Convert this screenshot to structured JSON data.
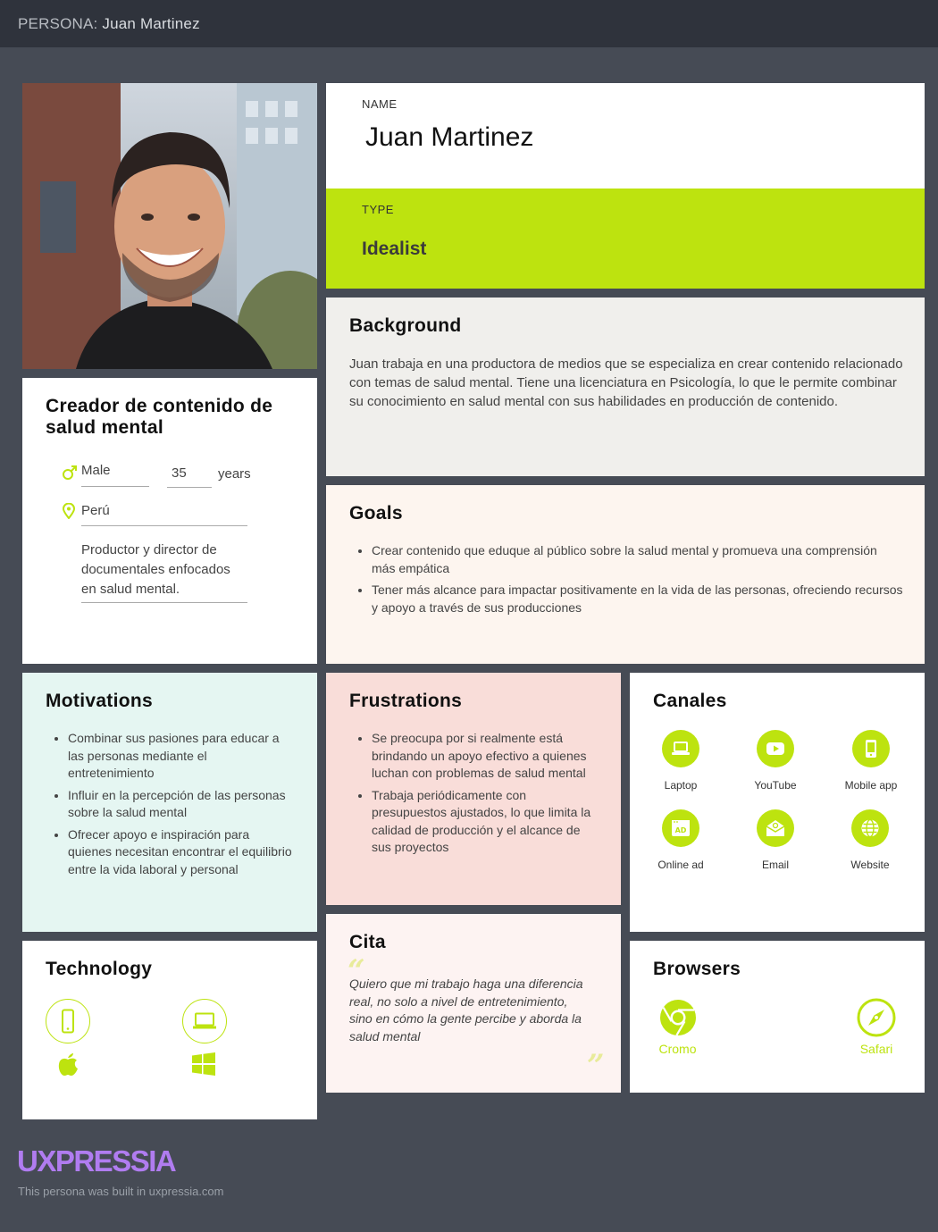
{
  "header": {
    "label": "PERSONA:",
    "name": "Juan Martinez"
  },
  "name_card": {
    "label": "NAME",
    "value": "Juan Martinez"
  },
  "type_card": {
    "label": "TYPE",
    "value": "Idealist"
  },
  "background": {
    "title": "Background",
    "text": "Juan trabaja en una productora de medios que se especializa en crear contenido relacionado con temas de salud mental. Tiene una licenciatura en Psicología, lo que le permite combinar su conocimiento en salud mental con sus habilidades en producción de contenido."
  },
  "goals": {
    "title": "Goals",
    "items": [
      "Crear contenido que eduque al público sobre la salud mental y promueva una comprensión más empática",
      "Tener más alcance para impactar positivamente en la vida de las personas, ofreciendo recursos y apoyo a través de sus producciones"
    ]
  },
  "profile": {
    "title": "Creador de contenido de salud mental",
    "gender": "Male",
    "age": "35",
    "age_unit": "years",
    "location": "Perú",
    "description": "Productor y director de documentales enfocados en salud mental."
  },
  "motivations": {
    "title": "Motivations",
    "items": [
      "Combinar sus pasiones para educar a las personas mediante el entretenimiento",
      "Influir en la percepción de las personas sobre la salud mental",
      "Ofrecer apoyo e inspiración para quienes necesitan encontrar el equilibrio entre la vida laboral y personal"
    ]
  },
  "frustrations": {
    "title": "Frustrations",
    "items": [
      "Se preocupa por si realmente está brindando un apoyo efectivo a quienes luchan con problemas de salud mental",
      "Trabaja periódicamente con presupuestos ajustados, lo que limita la calidad de producción y el alcance de sus proyectos"
    ]
  },
  "canales": {
    "title": "Canales",
    "items": [
      {
        "label": "Laptop",
        "icon": "laptop-icon"
      },
      {
        "label": "YouTube",
        "icon": "youtube-icon"
      },
      {
        "label": "Mobile app",
        "icon": "mobile-app-icon"
      },
      {
        "label": "Online ad",
        "icon": "online-ad-icon"
      },
      {
        "label": "Email",
        "icon": "email-icon"
      },
      {
        "label": "Website",
        "icon": "website-icon"
      }
    ]
  },
  "technology": {
    "title": "Technology",
    "devices": [
      "smartphone-icon",
      "laptop-icon"
    ],
    "os": [
      "apple-icon",
      "windows-icon"
    ]
  },
  "cita": {
    "title": "Cita",
    "quote": "Quiero que mi trabajo haga una diferencia real, no solo a nivel de entretenimiento, sino en cómo la gente percibe y aborda la salud mental"
  },
  "browsers": {
    "title": "Browsers",
    "items": [
      {
        "label": "Cromo",
        "icon": "chrome-icon"
      },
      {
        "label": "Safari",
        "icon": "safari-icon"
      }
    ]
  },
  "footer": {
    "logo": "UXPRESSIA",
    "note": "This persona was built in uxpressia.com"
  },
  "colors": {
    "accent": "#bde30f",
    "logo": "#b07cf0",
    "background": "#464b55"
  }
}
